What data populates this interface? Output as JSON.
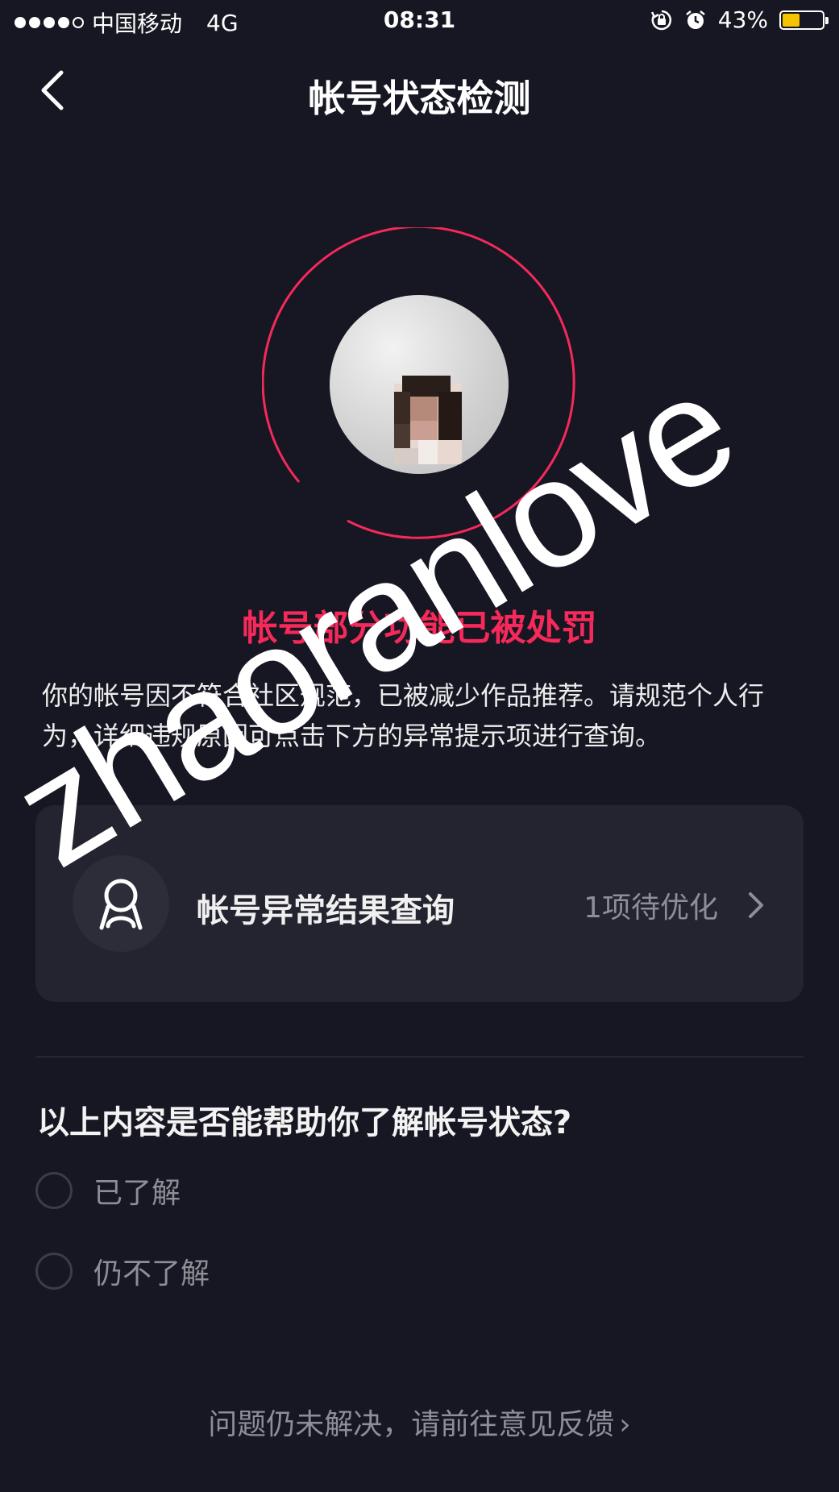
{
  "status_bar": {
    "carrier": "中国移动",
    "network": "4G",
    "time": "08:31",
    "battery": "43%",
    "battery_level": 0.43,
    "battery_color": "#f5c400"
  },
  "nav": {
    "title": "帐号状态检测",
    "back_icon": "chevron-left-icon"
  },
  "account": {
    "ring_color": "#f5295a",
    "status_title": "帐号部分功能已被处罚",
    "description": "你的帐号因不符合社区规范，已被减少作品推荐。请规范个人行为，详细违规原因可点击下方的异常提示项进行查询。"
  },
  "check_card": {
    "icon": "user-icon",
    "label": "帐号异常结果查询",
    "count": "1项待优化",
    "chevron_icon": "chevron-right-icon"
  },
  "survey": {
    "question": "以上内容是否能帮助你了解帐号状态?",
    "options": [
      "已了解",
      "仍不了解"
    ]
  },
  "feedback": {
    "label": "问题仍未解决，请前往意见反馈",
    "arrow": "›"
  },
  "watermark": "zhaoranlove"
}
